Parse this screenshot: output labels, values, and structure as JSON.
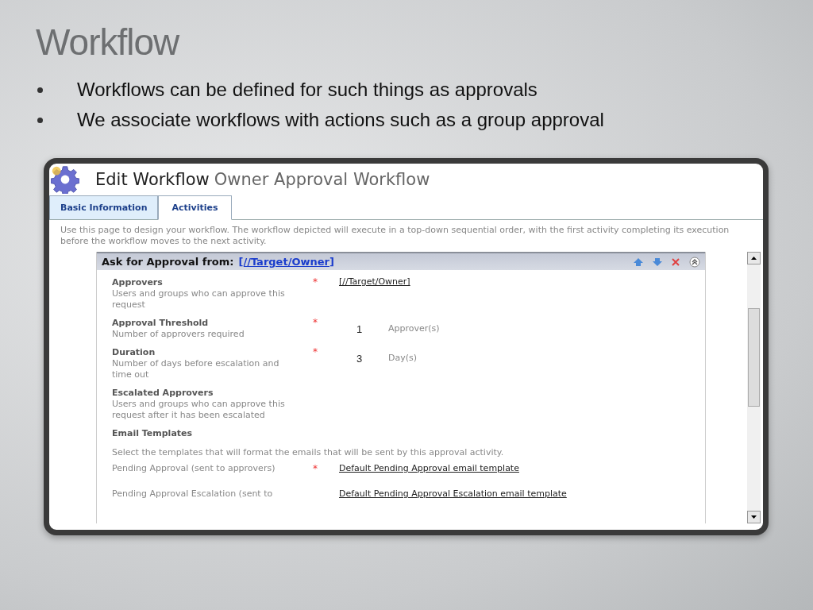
{
  "slide": {
    "title": "Workflow",
    "bullets": [
      "Workflows can be defined for such things as approvals",
      "We associate workflows with actions such as a group approval"
    ]
  },
  "window": {
    "title": "Edit Workflow",
    "subtitle": "Owner Approval Workflow"
  },
  "tabs": [
    {
      "label": "Basic Information",
      "selected": false
    },
    {
      "label": "Activities",
      "selected": true
    }
  ],
  "intro": "Use this page to design your workflow. The workflow depicted will execute in a top-down sequential order, with the first activity completing its execution before the workflow moves to the next activity.",
  "activity": {
    "heading": "Ask for Approval from:",
    "target": "[//Target/Owner]",
    "fields": [
      {
        "kind": "field",
        "label": "Approvers",
        "description": "Users and groups who can approve this request",
        "required_mark": "*",
        "value": "[//Target/Owner]"
      },
      {
        "kind": "field",
        "label": "Approval Threshold",
        "description": "Number of approvers required",
        "required_mark": "*",
        "value": "1",
        "unit": "Approver(s)"
      },
      {
        "kind": "field",
        "label": "Duration",
        "description": "Number of days before escalation and time out",
        "required_mark": "*",
        "value": "3",
        "unit": "Day(s)"
      },
      {
        "kind": "field",
        "label": "Escalated Approvers",
        "description": "Users and groups who can approve this request after it has been escalated"
      },
      {
        "kind": "section",
        "label": "Email Templates"
      },
      {
        "kind": "note",
        "label": "Select the templates that will format the emails that will be sent by this approval activity."
      },
      {
        "kind": "template",
        "label": "Pending Approval (sent to approvers)",
        "required_mark": "*",
        "value": "Default Pending Approval email template"
      },
      {
        "kind": "template",
        "label": "Pending Approval Escalation (sent to",
        "value": "Default Pending Approval Escalation email template"
      }
    ]
  }
}
